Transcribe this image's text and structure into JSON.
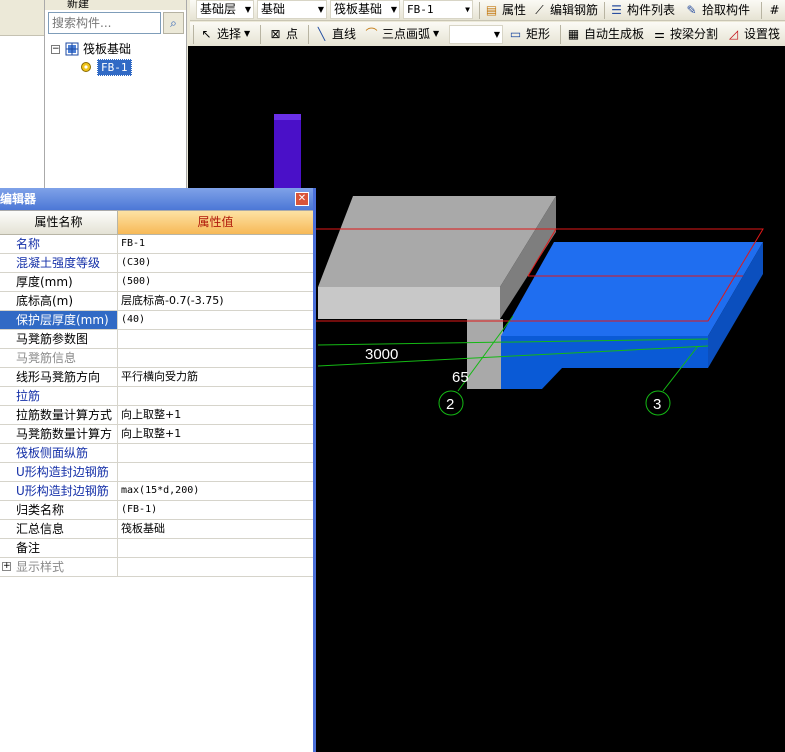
{
  "toolbar1": {
    "layer_combo": "基础层",
    "type_combo": "基础",
    "category_combo": "筏板基础",
    "item_combo": "FB-1",
    "property_btn": "属性",
    "edit_rebar_btn": "编辑钢筋",
    "component_list_btn": "构件列表",
    "pick_component_btn": "拾取构件"
  },
  "toolbar2": {
    "select_btn": "选择",
    "point_btn": "点",
    "line_btn": "直线",
    "arc_btn": "三点画弧",
    "rect_btn": "矩形",
    "auto_gen_btn": "自动生成板",
    "split_beam_btn": "按梁分割",
    "set_slope_btn": "设置筏"
  },
  "tree": {
    "top_label": "新建",
    "search_placeholder": "搜索构件...",
    "root_label": "筏板基础",
    "child_label": "FB-1"
  },
  "viewport": {
    "dim_label": "3000",
    "dim_label2": "65",
    "axis_2": "2",
    "axis_3": "3",
    "colors": {
      "slab": "#1f6ef0",
      "concrete": "#a8a8a8",
      "column": "#4a10c8",
      "outline": "#e01818",
      "axis": "#14b814"
    }
  },
  "editor": {
    "title": "编辑器",
    "col_name": "属性名称",
    "col_value": "属性值",
    "rows": [
      {
        "name": "名称",
        "value": "FB-1"
      },
      {
        "name": "混凝土强度等级",
        "value": "(C30)"
      },
      {
        "name": "厚度(mm)",
        "value": "(500)"
      },
      {
        "name": "底标高(m)",
        "value": "层底标高-0.7(-3.75)"
      },
      {
        "name": "保护层厚度(mm)",
        "value": "(40)"
      },
      {
        "name": "马凳筋参数图",
        "value": ""
      },
      {
        "name": "马凳筋信息",
        "value": ""
      },
      {
        "name": "线形马凳筋方向",
        "value": "平行横向受力筋"
      },
      {
        "name": "拉筋",
        "value": ""
      },
      {
        "name": "拉筋数量计算方式",
        "value": "向上取整+1"
      },
      {
        "name": "马凳筋数量计算方",
        "value": "向上取整+1"
      },
      {
        "name": "筏板侧面纵筋",
        "value": ""
      },
      {
        "name": "U形构造封边钢筋",
        "value": ""
      },
      {
        "name": "U形构造封边钢筋",
        "value": "max(15*d,200)"
      },
      {
        "name": "归类名称",
        "value": "(FB-1)"
      },
      {
        "name": "汇总信息",
        "value": "筏板基础"
      },
      {
        "name": "备注",
        "value": ""
      },
      {
        "name": "显示样式",
        "value": ""
      }
    ]
  }
}
